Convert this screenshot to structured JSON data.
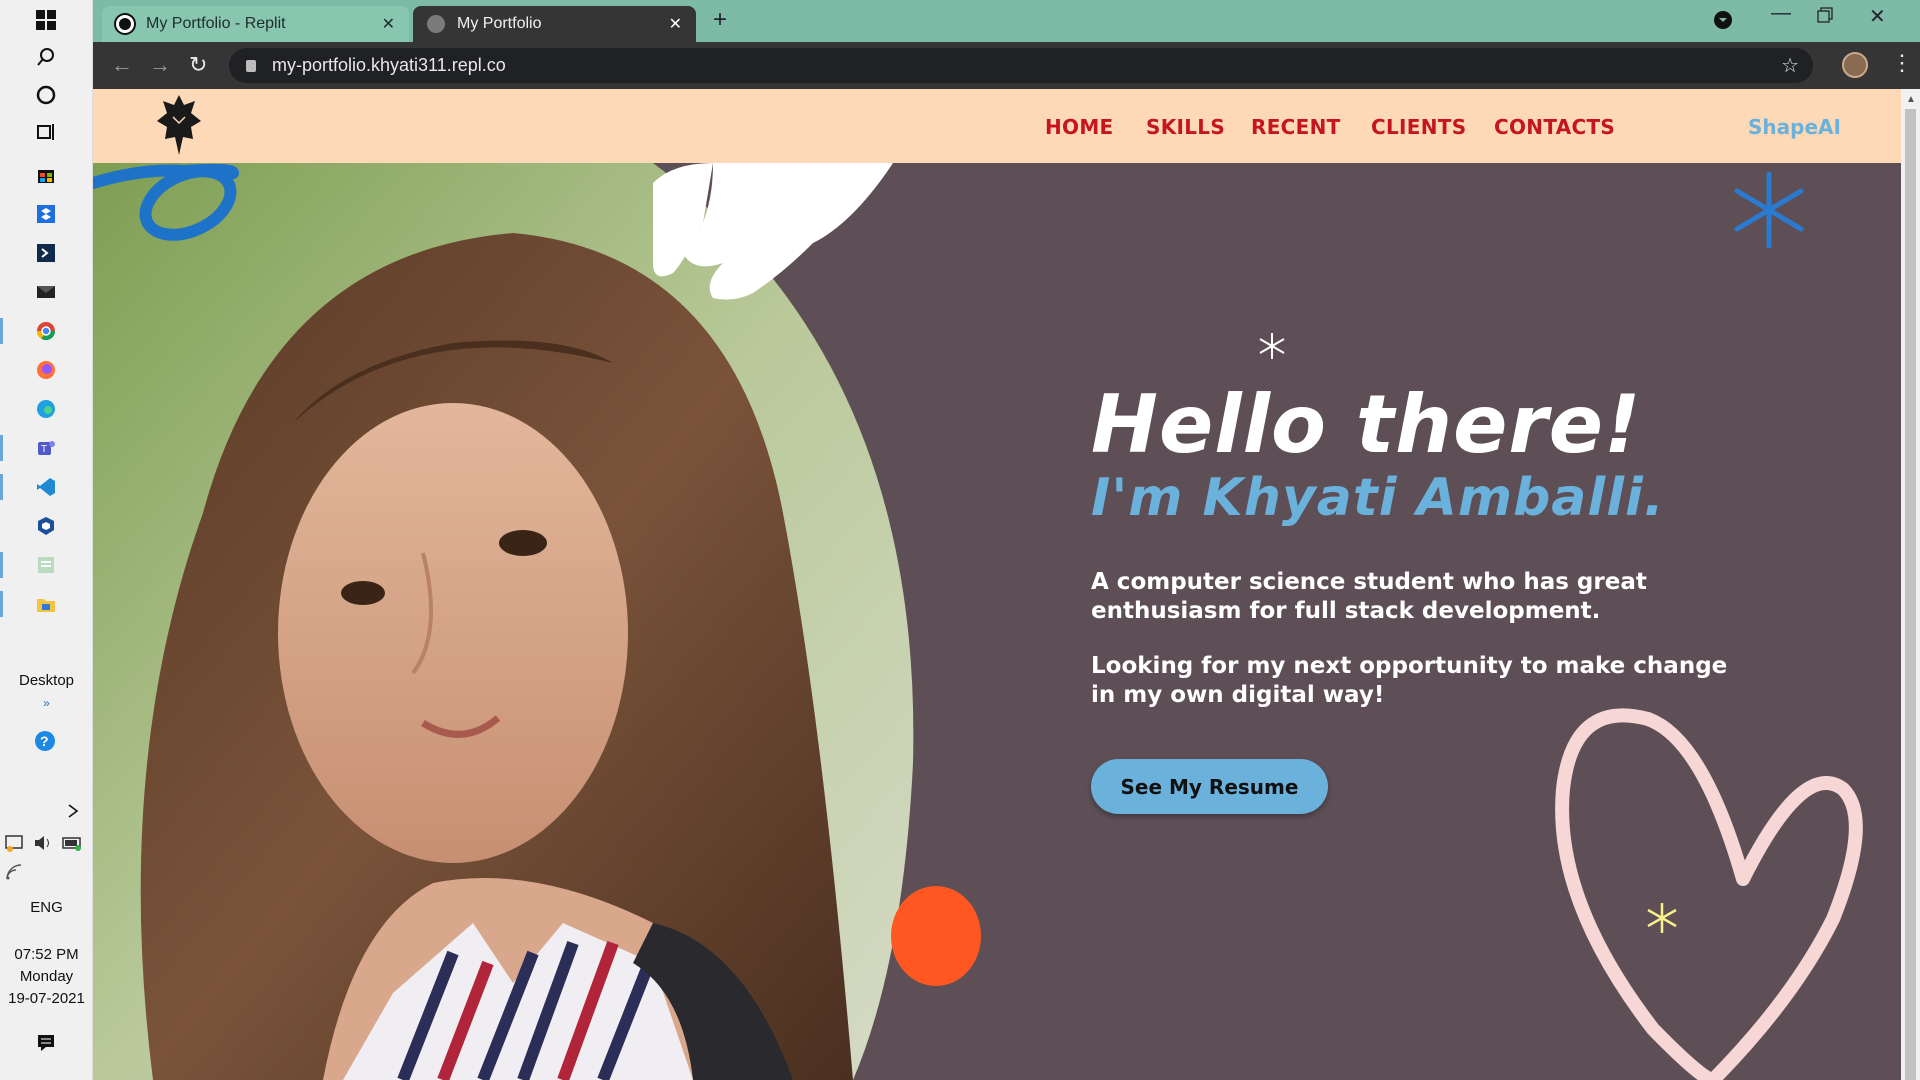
{
  "taskbar": {
    "desktop_label": "Desktop",
    "language": "ENG",
    "time": "07:52 PM",
    "day": "Monday",
    "date": "19-07-2021"
  },
  "browser": {
    "tabs": [
      {
        "title": "My Portfolio - Replit"
      },
      {
        "title": "My Portfolio"
      }
    ],
    "url": "my-portfolio.khyati311.repl.co"
  },
  "site": {
    "nav": [
      "HOME",
      "SKILLS",
      "RECENT",
      "CLIENTS",
      "CONTACTS"
    ],
    "brand": "ShapeAI",
    "hello": "Hello there!",
    "name": "I'm Khyati Amballi.",
    "para1": "A computer science student who has great enthusiasm for full stack development.",
    "para2": "Looking for my next opportunity to make change in my own digital way!",
    "resume_button": "See My Resume"
  },
  "colors": {
    "page_bg": "#5e4f57",
    "header_bg": "#fed9b7",
    "nav_red": "#c4161c",
    "accent_blue": "#6ab1dc",
    "blob_orange": "#ff5722",
    "heart_pink": "#f7d6d6"
  }
}
